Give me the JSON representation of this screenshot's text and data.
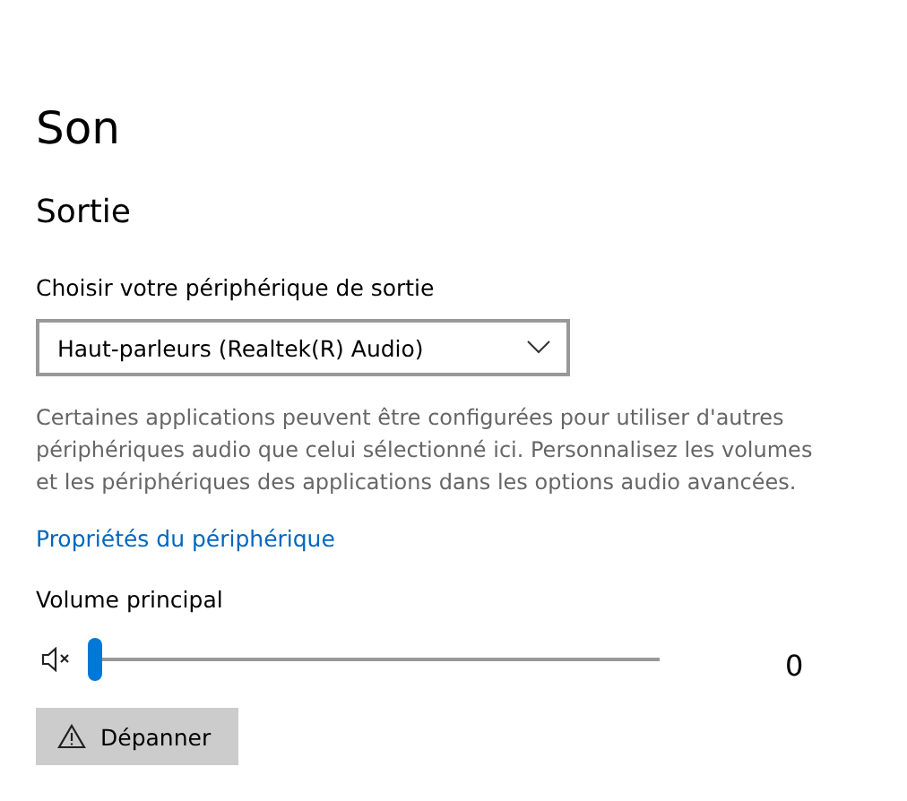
{
  "page": {
    "title": "Son"
  },
  "section": {
    "title": "Sortie"
  },
  "output_device": {
    "label": "Choisir votre périphérique de sortie",
    "value": "Haut-parleurs (Realtek(R) Audio)"
  },
  "description": "Certaines applications peuvent être configurées pour utiliser d'autres périphériques audio que celui sélectionné ici. Personnalisez les volumes et les périphériques des applications dans les options audio avancées.",
  "device_properties_link": "Propriétés du périphérique",
  "volume": {
    "label": "Volume principal",
    "muted": true,
    "level": 0,
    "reading": "0"
  },
  "troubleshoot_button": "Dépanner"
}
